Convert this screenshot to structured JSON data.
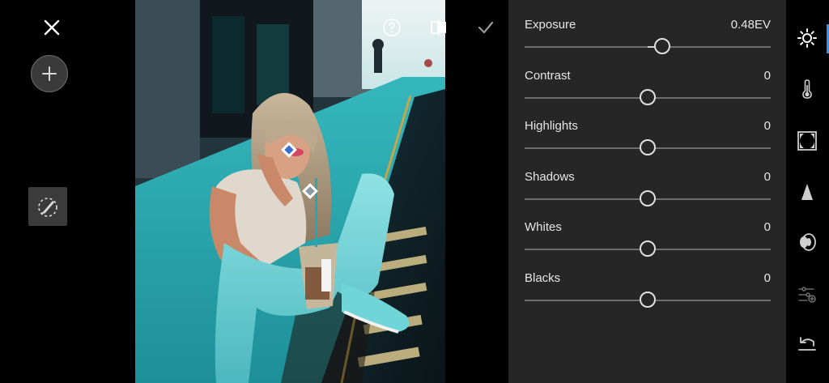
{
  "left_toolbar": {
    "close_icon": "close-icon",
    "add_icon": "plus-icon",
    "brush_icon": "brush-healing-icon"
  },
  "top_icons": {
    "help_icon": "help-icon",
    "compare_icon": "compare-icon",
    "confirm_icon": "checkmark-icon"
  },
  "adjustments": [
    {
      "label": "Exposure",
      "value": "0.48EV",
      "position": 0.56
    },
    {
      "label": "Contrast",
      "value": "0",
      "position": 0.5
    },
    {
      "label": "Highlights",
      "value": "0",
      "position": 0.5
    },
    {
      "label": "Shadows",
      "value": "0",
      "position": 0.5
    },
    {
      "label": "Whites",
      "value": "0",
      "position": 0.5
    },
    {
      "label": "Blacks",
      "value": "0",
      "position": 0.5
    }
  ],
  "tool_strip": [
    {
      "icon": "light-sun-icon",
      "active": true
    },
    {
      "icon": "color-thermometer-icon",
      "active": false
    },
    {
      "icon": "effects-vignette-icon",
      "active": false
    },
    {
      "icon": "detail-triangle-icon",
      "active": false
    },
    {
      "icon": "optics-lens-icon",
      "active": false
    },
    {
      "icon": "geometry-sliders-icon",
      "active": false,
      "disabled": true
    },
    {
      "icon": "undo-icon",
      "active": false
    }
  ],
  "colors": {
    "panel_bg": "#262626",
    "accent": "#3d8ee8",
    "text": "#e6e6e6"
  }
}
